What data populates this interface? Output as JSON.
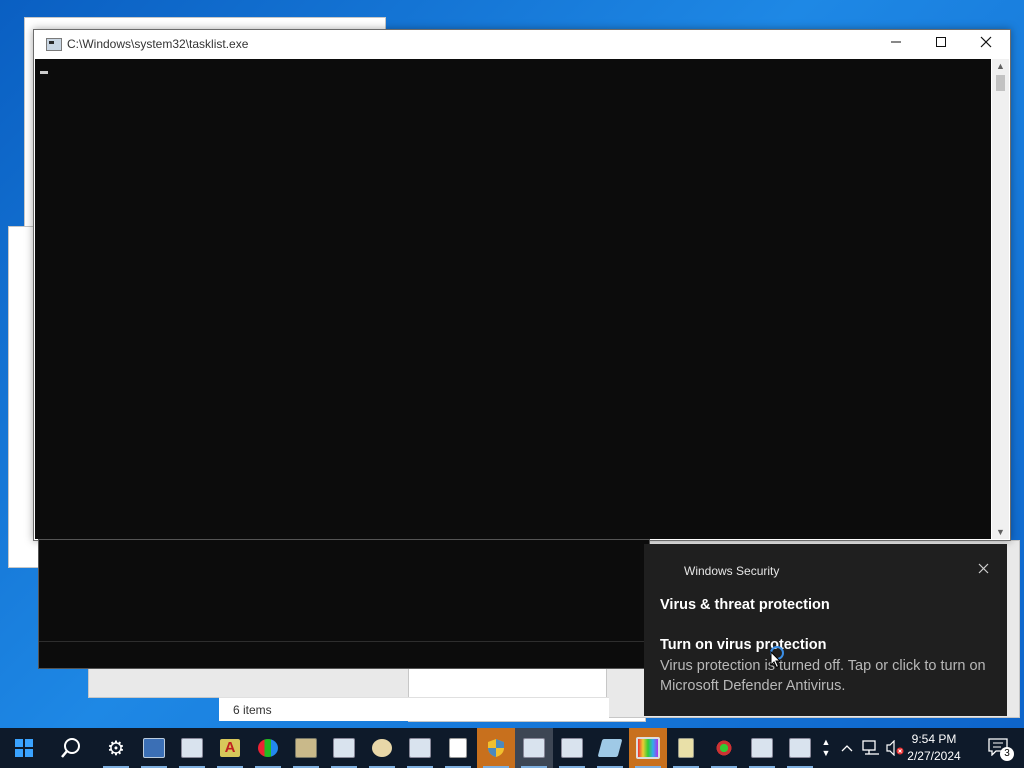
{
  "console": {
    "title": "C:\\Windows\\system32\\tasklist.exe",
    "minimize_icon": "minimize-icon",
    "maximize_icon": "maximize-icon",
    "close_icon": "close-icon"
  },
  "explorer": {
    "status_items": "6 items"
  },
  "toast": {
    "app_name": "Windows Security",
    "heading": "Virus & threat protection",
    "subheading": "Turn on virus protection",
    "body": "Virus protection is turned off. Tap or click to turn on Microsoft Defender Antivirus."
  },
  "taskbar": {
    "time": "9:54 PM",
    "date": "2/27/2024",
    "notification_count": "3"
  }
}
